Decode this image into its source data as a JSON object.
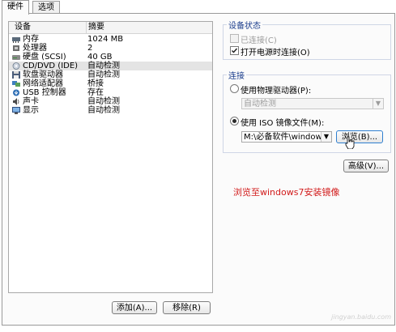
{
  "tabs": [
    {
      "label": "硬件"
    },
    {
      "label": "选项"
    }
  ],
  "device_list": {
    "headers": {
      "device": "设备",
      "summary": "摘要"
    },
    "rows": [
      {
        "name": "内存",
        "summary": "1024 MB",
        "icon": "memory-icon"
      },
      {
        "name": "处理器",
        "summary": "2",
        "icon": "processor-icon"
      },
      {
        "name": "硬盘 (SCSI)",
        "summary": "40 GB",
        "icon": "hard-disk-icon"
      },
      {
        "name": "CD/DVD (IDE)",
        "summary": "自动检测",
        "icon": "cd-dvd-icon",
        "selected": true
      },
      {
        "name": "软盘驱动器",
        "summary": "自动检测",
        "icon": "floppy-icon"
      },
      {
        "name": "网络适配器",
        "summary": "桥接",
        "icon": "network-adapter-icon"
      },
      {
        "name": "USB 控制器",
        "summary": "存在",
        "icon": "usb-icon"
      },
      {
        "name": "声卡",
        "summary": "自动检测",
        "icon": "sound-card-icon"
      },
      {
        "name": "显示",
        "summary": "自动检测",
        "icon": "display-icon"
      }
    ]
  },
  "buttons": {
    "add": "添加(A)...",
    "remove": "移除(R)"
  },
  "device_status": {
    "title": "设备状态",
    "connected": {
      "label": "已连接(C)",
      "checked": false,
      "disabled": true
    },
    "connect_on_power": {
      "label": "打开电源时连接(O)",
      "checked": true
    }
  },
  "connection": {
    "title": "连接",
    "physical": {
      "label": "使用物理驱动器(P):",
      "selected": false
    },
    "physical_select": "自动检测",
    "iso": {
      "label": "使用 ISO 镜像文件(M):",
      "selected": true
    },
    "iso_path": "M:\\必备软件\\windows\\",
    "browse": "浏览(B)...",
    "advanced": "高级(V)..."
  },
  "annotation": "浏览至windows7安装镜像",
  "watermark": "jingyan.baidu.com",
  "colors": {
    "annotation": "#d21b1b",
    "group_title": "#1b3d8c"
  }
}
